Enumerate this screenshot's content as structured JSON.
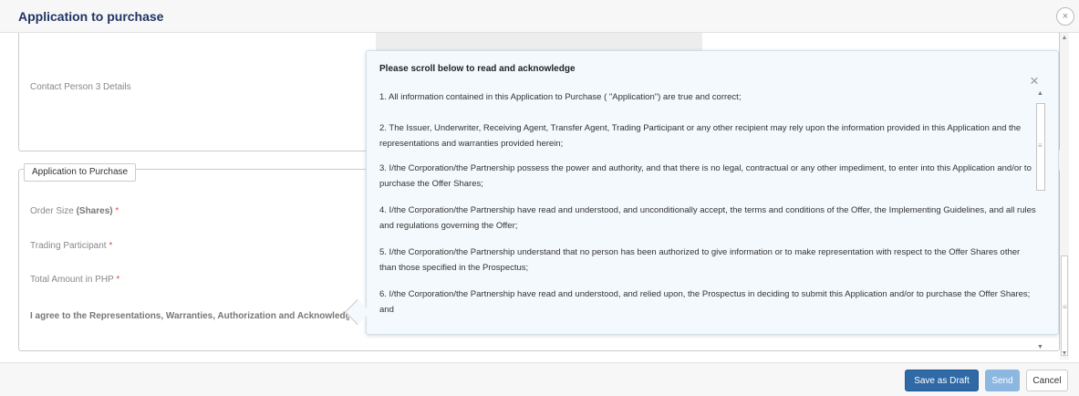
{
  "modal": {
    "title": "Application to purchase",
    "close_glyph": "×"
  },
  "contact_section": {
    "contact_person_3_label": "Contact Person 3 Details"
  },
  "application_section": {
    "legend": "Application to Purchase",
    "order_size_label": "Order Size",
    "order_size_unit": "(Shares)",
    "trading_participant_label": "Trading Participant",
    "total_amount_label": "Total Amount in PHP",
    "required_marker": "*",
    "agree_label": "I agree to the Representations, Warranties, Authorization and Acknowledgm"
  },
  "popover": {
    "title": "Please scroll below to read and acknowledge",
    "close_glyph": "×",
    "items": [
      "1. All information contained in this Application to Purchase ( \"Application\") are true and correct;",
      "2. The Issuer, Underwriter, Receiving Agent, Transfer Agent, Trading Participant or any other recipient may rely upon the information provided in this Application and the representations and warranties provided herein;",
      "3. I/the Corporation/the Partnership possess the power and authority, and that there is no legal, contractual or any other impediment, to enter into this Application and/or to purchase the Offer Shares;",
      "4. I/the Corporation/the Partnership have read and understood, and unconditionally accept, the terms and conditions of the Offer, the Implementing Guidelines, and all rules and regulations governing the Offer;",
      "5. I/the Corporation/the Partnership understand that no person has been authorized to give information or to make representation with respect to the Offer Shares other than those specified in the Prospectus;",
      "6. I/the Corporation/the Partnership have read and understood, and relied upon, the Prospectus in deciding to submit this Application and/or to purchase the Offer Shares; and"
    ]
  },
  "footer": {
    "save_draft_label": "Save as Draft",
    "send_label": "Send",
    "cancel_label": "Cancel"
  },
  "colors": {
    "title_color": "#1f3364",
    "primary_button": "#2f6aa6",
    "disabled_button": "#8cb7e1",
    "required_color": "#d9534f",
    "popover_bg": "#f4f9fd"
  }
}
